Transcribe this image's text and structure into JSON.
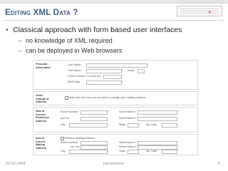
{
  "slide": {
    "title": "Editing XML Data ?",
    "bullets": [
      {
        "text": "Classical approach with form based user interfaces"
      }
    ],
    "subbullets": [
      {
        "text": "no knowledge of XML required"
      },
      {
        "text": "can be deployed in Web browsers"
      }
    ]
  },
  "form": {
    "personal": {
      "title": "Personal Information",
      "last_name": "Last Name",
      "first_name": "First Name",
      "initial": "Initial",
      "driver_license": "Driver License / Id Card No.",
      "birth_date": "Birth Date"
    },
    "change": {
      "title": "Order Change of Address",
      "note": "Mark this box if you do not want to change your mailing address"
    },
    "new_residence": {
      "title": "New or Current Residence Address",
      "street_number": "Street Number",
      "street_name1": "Street Name 1",
      "apt_no": "Apt. No.",
      "street_name2": "Street Name 2",
      "city": "City",
      "state": "State",
      "zip": "Zip Code"
    },
    "mailing": {
      "title": "New or Current Mailing Address",
      "option": "Remove Mailing Address",
      "street_number": "Street Number",
      "street_name1": "Street Name 1",
      "apt_no": "Apt. No.",
      "street_name2": "Street Name 2",
      "city": "City",
      "state": "State",
      "zip": "Zip Code"
    }
  },
  "footer": {
    "date": "23.02.2009",
    "center": "Introduction",
    "page": "6"
  },
  "colors": {
    "title": "#3b5d86",
    "required": "#dd3333"
  }
}
